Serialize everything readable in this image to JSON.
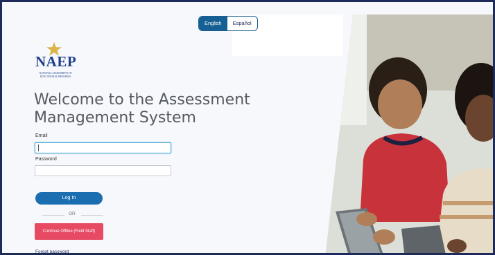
{
  "language": {
    "english": "English",
    "spanish": "Español",
    "active": "English"
  },
  "logo": {
    "name": "NAEP",
    "subtitle": "NATIONAL ASSESSMENT OF EDUCATIONAL PROGRESS"
  },
  "heading": "Welcome to the Assessment Management System",
  "form": {
    "email_label": "Email",
    "email_value": "",
    "password_label": "Password",
    "password_value": "",
    "login_label": "Log In",
    "or_label": "OR",
    "offline_label": "Continue Offline (Field Staff)",
    "forgot_label": "Forgot password"
  },
  "colors": {
    "primary": "#1b6fb0",
    "offline": "#e74a63",
    "heading": "#555a62",
    "frame": "#1c2b57"
  },
  "photo": {
    "description_icon": "students-using-tablets-photo"
  }
}
